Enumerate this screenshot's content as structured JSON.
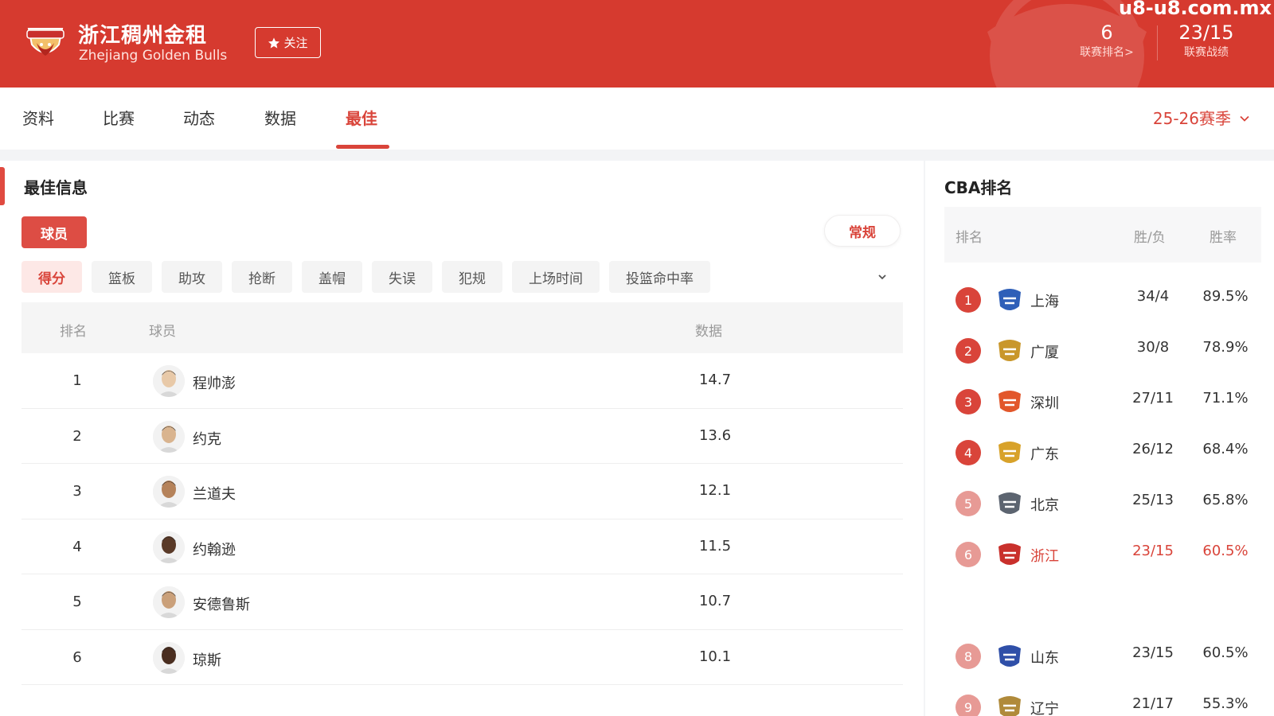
{
  "header": {
    "team_cn": "浙江稠州金租",
    "team_en": "Zhejiang Golden Bulls",
    "follow_label": "关注",
    "rank_value": "6",
    "rank_label": "联赛排名>",
    "record_value": "23/15",
    "record_label": "联赛战绩",
    "watermark": "u8-u8.com.mx"
  },
  "nav": {
    "tabs": [
      "资料",
      "比赛",
      "动态",
      "数据",
      "最佳"
    ],
    "active_tab": "最佳",
    "season": "25-26赛季"
  },
  "best": {
    "title": "最佳信息",
    "player_pill": "球员",
    "mode_pill": "常规",
    "categories": [
      "得分",
      "篮板",
      "助攻",
      "抢断",
      "盖帽",
      "失误",
      "犯规",
      "上场时间",
      "投篮命中率"
    ],
    "active_category": "得分",
    "columns": {
      "rank": "排名",
      "player": "球员",
      "data": "数据"
    },
    "rows": [
      {
        "rank": "1",
        "name": "程帅澎",
        "value": "14.7"
      },
      {
        "rank": "2",
        "name": "约克",
        "value": "13.6"
      },
      {
        "rank": "3",
        "name": "兰道夫",
        "value": "12.1"
      },
      {
        "rank": "4",
        "name": "约翰逊",
        "value": "11.5"
      },
      {
        "rank": "5",
        "name": "安德鲁斯",
        "value": "10.7"
      },
      {
        "rank": "6",
        "name": "琼斯",
        "value": "10.1"
      }
    ]
  },
  "standings": {
    "title": "CBA排名",
    "columns": {
      "rank": "排名",
      "wl": "胜/负",
      "pct": "胜率"
    },
    "rows": [
      {
        "rank": "1",
        "team": "上海",
        "wl": "34/4",
        "pct": "89.5%"
      },
      {
        "rank": "2",
        "team": "广厦",
        "wl": "30/8",
        "pct": "78.9%"
      },
      {
        "rank": "3",
        "team": "深圳",
        "wl": "27/11",
        "pct": "71.1%"
      },
      {
        "rank": "4",
        "team": "广东",
        "wl": "26/12",
        "pct": "68.4%"
      },
      {
        "rank": "5",
        "team": "北京",
        "wl": "25/13",
        "pct": "65.8%"
      },
      {
        "rank": "6",
        "team": "浙江",
        "wl": "23/15",
        "pct": "60.5%"
      },
      {
        "rank": "8",
        "team": "山东",
        "wl": "23/15",
        "pct": "60.5%"
      },
      {
        "rank": "9",
        "team": "辽宁",
        "wl": "21/17",
        "pct": "55.3%"
      }
    ],
    "highlight_team": "浙江"
  },
  "colors": {
    "brand": "#d63a2f",
    "accent": "#d9443a",
    "rank_top3": "#d9443a",
    "rank_other": "#e79a95"
  }
}
